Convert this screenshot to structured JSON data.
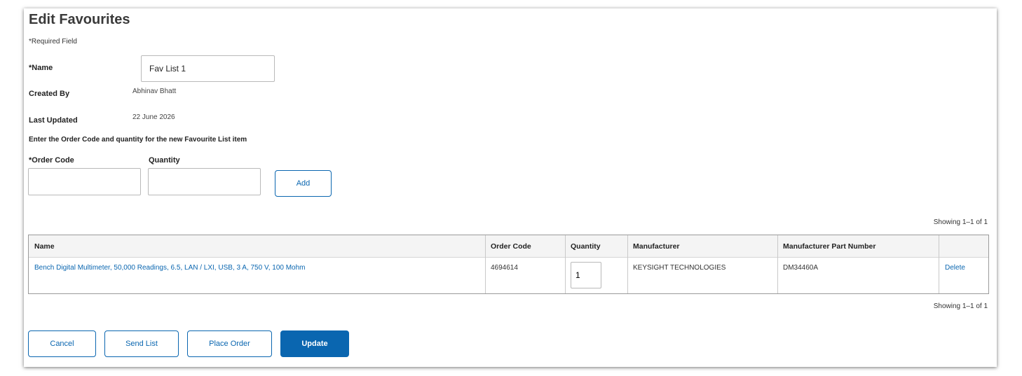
{
  "page": {
    "title": "Edit Favourites",
    "required_note": "*Required Field"
  },
  "form": {
    "name_label": "*Name",
    "name_value": "Fav List 1",
    "created_by_label": "Created By",
    "created_by_value": "Abhinav Bhatt",
    "last_updated_label": "Last Updated",
    "last_updated_value": "22 June 2026",
    "instruction": "Enter the Order Code and quantity for the new Favourite List item",
    "order_code_label": "*Order Code",
    "order_code_value": "",
    "quantity_label": "Quantity",
    "quantity_value": "",
    "add_label": "Add"
  },
  "table": {
    "showing_top": "Showing 1–1 of 1",
    "showing_bottom": "Showing 1–1 of 1",
    "headers": [
      "Name",
      "Order Code",
      "Quantity",
      "Manufacturer",
      "Manufacturer Part Number",
      ""
    ],
    "rows": [
      {
        "name": "Bench Digital Multimeter, 50,000 Readings, 6.5, LAN / LXI, USB, 3 A, 750 V, 100 Mohm",
        "order_code": "4694614",
        "quantity": "1",
        "manufacturer": "KEYSIGHT TECHNOLOGIES",
        "part_number": "DM34460A",
        "action": "Delete"
      }
    ]
  },
  "actions": {
    "cancel": "Cancel",
    "send_list": "Send List",
    "place_order": "Place Order",
    "update": "Update"
  },
  "colors": {
    "accent": "#0a66b0",
    "border": "#b9b9b9",
    "header_bg": "#f4f4f4"
  }
}
